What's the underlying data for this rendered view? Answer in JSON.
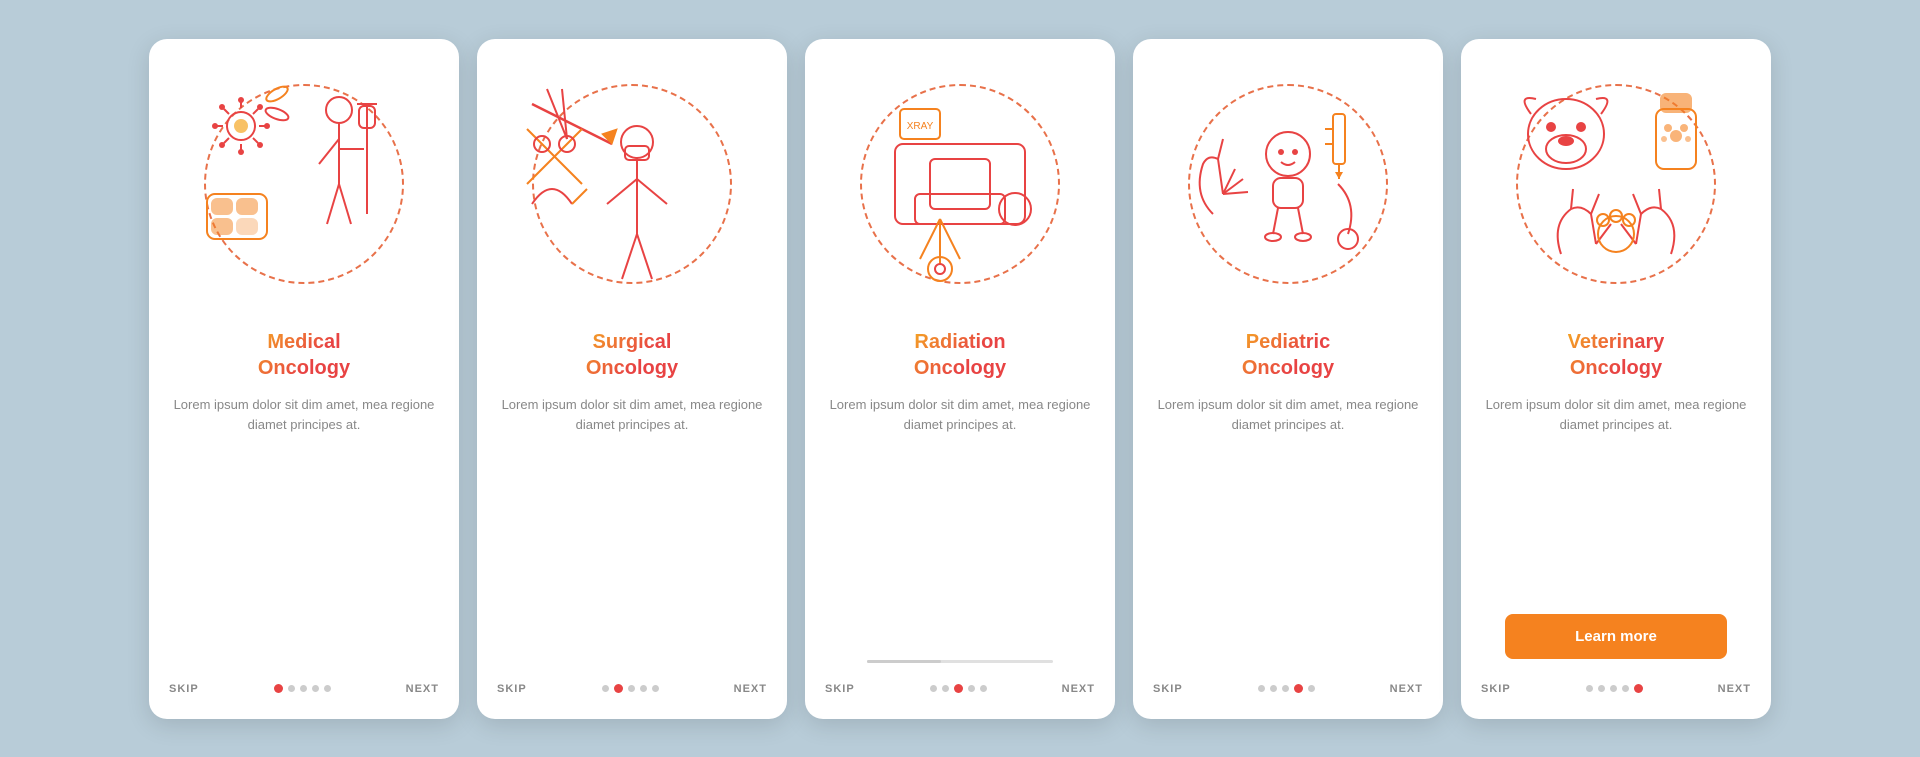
{
  "cards": [
    {
      "id": "medical-oncology",
      "title": "Medical\nOncology",
      "description": "Lorem ipsum dolor sit dim amet, mea regione diamet principes at.",
      "dots": [
        true,
        false,
        false,
        false,
        false
      ],
      "activeDot": 0,
      "showLearnMore": false,
      "showProgress": false
    },
    {
      "id": "surgical-oncology",
      "title": "Surgical\nOncology",
      "description": "Lorem ipsum dolor sit dim amet, mea regione diamet principes at.",
      "dots": [
        false,
        true,
        false,
        false,
        false
      ],
      "activeDot": 1,
      "showLearnMore": false,
      "showProgress": false
    },
    {
      "id": "radiation-oncology",
      "title": "Radiation\nOncology",
      "description": "Lorem ipsum dolor sit dim amet, mea regione diamet principes at.",
      "dots": [
        false,
        false,
        true,
        false,
        false
      ],
      "activeDot": 2,
      "showLearnMore": false,
      "showProgress": true
    },
    {
      "id": "pediatric-oncology",
      "title": "Pediatric\nOncology",
      "description": "Lorem ipsum dolor sit dim amet, mea regione diamet principes at.",
      "dots": [
        false,
        false,
        false,
        true,
        false
      ],
      "activeDot": 3,
      "showLearnMore": false,
      "showProgress": false
    },
    {
      "id": "veterinary-oncology",
      "title": "Veterinary\nOncology",
      "description": "Lorem ipsum dolor sit dim amet, mea regione diamet principes at.",
      "dots": [
        false,
        false,
        false,
        false,
        true
      ],
      "activeDot": 4,
      "showLearnMore": true,
      "showProgress": false
    }
  ],
  "labels": {
    "skip": "SKIP",
    "next": "NEXT",
    "learn_more": "Learn more"
  }
}
